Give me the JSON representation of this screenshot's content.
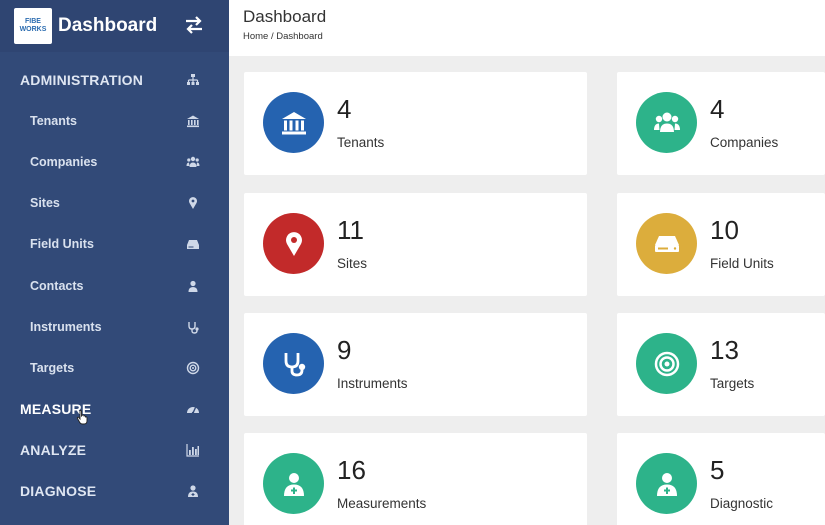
{
  "brand": {
    "logo_text": "FIBE WORKS",
    "title": "Dashboard",
    "toggle_icon": "swap-arrows-icon"
  },
  "sidebar": {
    "items": [
      {
        "label": "ADMINISTRATION",
        "icon": "sitemap-icon",
        "type": "section"
      },
      {
        "label": "Tenants",
        "icon": "bank-icon",
        "type": "sub"
      },
      {
        "label": "Companies",
        "icon": "users-icon",
        "type": "sub"
      },
      {
        "label": "Sites",
        "icon": "map-pin-icon",
        "type": "sub"
      },
      {
        "label": "Field Units",
        "icon": "hdd-icon",
        "type": "sub"
      },
      {
        "label": "Contacts",
        "icon": "user-icon",
        "type": "sub"
      },
      {
        "label": "Instruments",
        "icon": "stethoscope-icon",
        "type": "sub"
      },
      {
        "label": "Targets",
        "icon": "target-icon",
        "type": "sub"
      },
      {
        "label": "MEASURE",
        "icon": "dashboard-gauge-icon",
        "type": "section",
        "active": true
      },
      {
        "label": "ANALYZE",
        "icon": "bar-chart-icon",
        "type": "section"
      },
      {
        "label": "DIAGNOSE",
        "icon": "user-md-icon",
        "type": "section"
      }
    ]
  },
  "header": {
    "title": "Dashboard",
    "breadcrumb": "Home / Dashboard"
  },
  "cards": [
    {
      "value": "4",
      "label": "Tenants",
      "icon": "bank-icon",
      "color": "#2563b0"
    },
    {
      "value": "4",
      "label": "Companies",
      "icon": "users-icon",
      "color": "#2db38a"
    },
    {
      "value": "11",
      "label": "Sites",
      "icon": "map-pin-icon",
      "color": "#c22a2a"
    },
    {
      "value": "10",
      "label": "Field Units",
      "icon": "hdd-icon",
      "color": "#dcad3c"
    },
    {
      "value": "9",
      "label": "Instruments",
      "icon": "stethoscope-icon",
      "color": "#2563b0"
    },
    {
      "value": "13",
      "label": "Targets",
      "icon": "target-icon",
      "color": "#2db38a"
    },
    {
      "value": "16",
      "label": "Measurements",
      "icon": "user-md-icon",
      "color": "#2db38a"
    },
    {
      "value": "5",
      "label": "Diagnostic",
      "icon": "user-md-icon",
      "color": "#2db38a"
    }
  ],
  "colors": {
    "sidebar_bg": "#324a78",
    "page_bg": "#eeeeee",
    "card_bg": "#ffffff"
  }
}
